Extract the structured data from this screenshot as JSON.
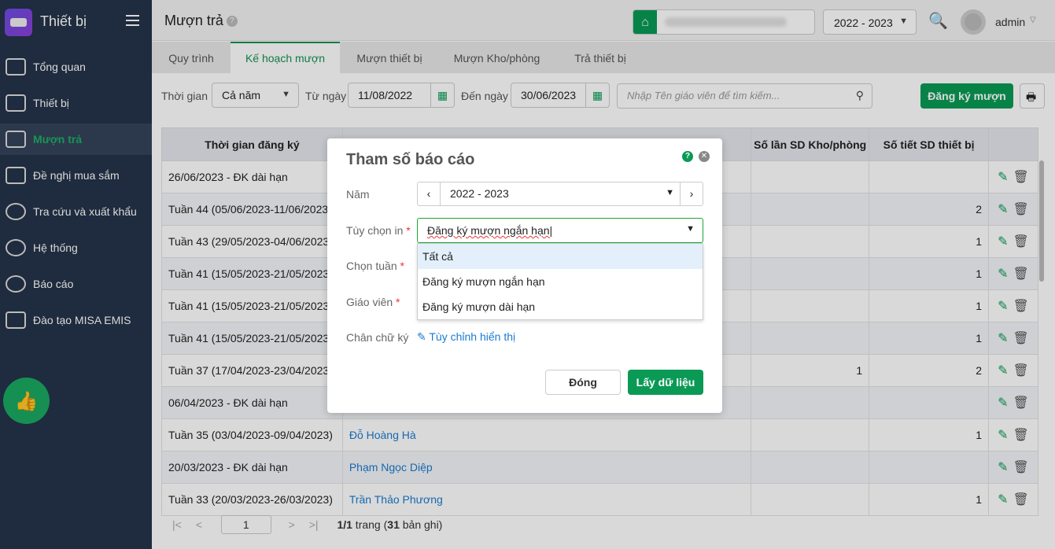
{
  "sidebar": {
    "app_title": "Thiết bị",
    "items": [
      {
        "label": "Tổng quan"
      },
      {
        "label": "Thiết bị"
      },
      {
        "label": "Mượn trả"
      },
      {
        "label": "Đề nghị mua sắm"
      },
      {
        "label": "Tra cứu và xuất khẩu"
      },
      {
        "label": "Hệ thống"
      },
      {
        "label": "Báo cáo"
      },
      {
        "label": "Đào tạo MISA EMIS"
      }
    ]
  },
  "header": {
    "title": "Mượn trả",
    "help": "?",
    "school_year": "2022 - 2023",
    "user": "admin"
  },
  "tabs": [
    {
      "label": "Quy trình"
    },
    {
      "label": "Kế hoạch mượn"
    },
    {
      "label": "Mượn thiết bị"
    },
    {
      "label": "Mượn Kho/phòng"
    },
    {
      "label": "Trả thiết bị"
    }
  ],
  "filters": {
    "time_label": "Thời gian",
    "time_value": "Cả năm",
    "from_label": "Từ ngày",
    "from_value": "11/08/2022",
    "to_label": "Đến ngày",
    "to_value": "30/06/2023",
    "search_placeholder": "Nhập Tên giáo viên để tìm kiếm...",
    "register_button": "Đăng ký mượn"
  },
  "table": {
    "headers": [
      "Thời gian đăng ký",
      "",
      "Số lần SD Kho/phòng",
      "Số tiết SD thiết bị"
    ],
    "rows": [
      {
        "time": "26/06/2023 - ĐK dài hạn",
        "teacher": "",
        "rooms": "",
        "periods": ""
      },
      {
        "time": "Tuần 44 (05/06/2023-11/06/2023)",
        "teacher": "",
        "rooms": "",
        "periods": "2"
      },
      {
        "time": "Tuần 43 (29/05/2023-04/06/2023)",
        "teacher": "",
        "rooms": "",
        "periods": "1"
      },
      {
        "time": "Tuần 41 (15/05/2023-21/05/2023)",
        "teacher": "",
        "rooms": "",
        "periods": "1"
      },
      {
        "time": "Tuần 41 (15/05/2023-21/05/2023)",
        "teacher": "",
        "rooms": "",
        "periods": "1"
      },
      {
        "time": "Tuần 41 (15/05/2023-21/05/2023)",
        "teacher": "",
        "rooms": "",
        "periods": "1"
      },
      {
        "time": "Tuần 37 (17/04/2023-23/04/2023)",
        "teacher": "",
        "rooms": "1",
        "periods": "2"
      },
      {
        "time": "06/04/2023 - ĐK dài hạn",
        "teacher": "",
        "rooms": "",
        "periods": ""
      },
      {
        "time": "Tuần 35 (03/04/2023-09/04/2023)",
        "teacher": "Đỗ Hoàng Hà",
        "rooms": "",
        "periods": "1"
      },
      {
        "time": "20/03/2023 - ĐK dài hạn",
        "teacher": "Phạm Ngọc Diệp",
        "rooms": "",
        "periods": ""
      },
      {
        "time": "Tuần 33 (20/03/2023-26/03/2023)",
        "teacher": "Trần Thảo Phương",
        "rooms": "",
        "periods": "1"
      }
    ]
  },
  "pager": {
    "page": "1",
    "summary_pages": "1/1",
    "summary_mid": " trang (",
    "summary_count": "31",
    "summary_end": " bản ghi)"
  },
  "modal": {
    "title": "Tham số báo cáo",
    "year_label": "Năm",
    "year_value": "2022 - 2023",
    "print_option_label": "Tùy chọn in",
    "print_option_value": "Đăng ký mượn ngắn hạn",
    "week_label": "Chọn tuần",
    "teacher_label": "Giáo viên",
    "signature_label": "Chân chữ ký",
    "signature_link": "Tùy chỉnh hiển thị",
    "required": "*",
    "options": [
      "Tất cả",
      "Đăng ký mượn ngắn hạn",
      "Đăng ký mượn dài hạn"
    ],
    "close_button": "Đóng",
    "fetch_button": "Lấy dữ liệu"
  }
}
